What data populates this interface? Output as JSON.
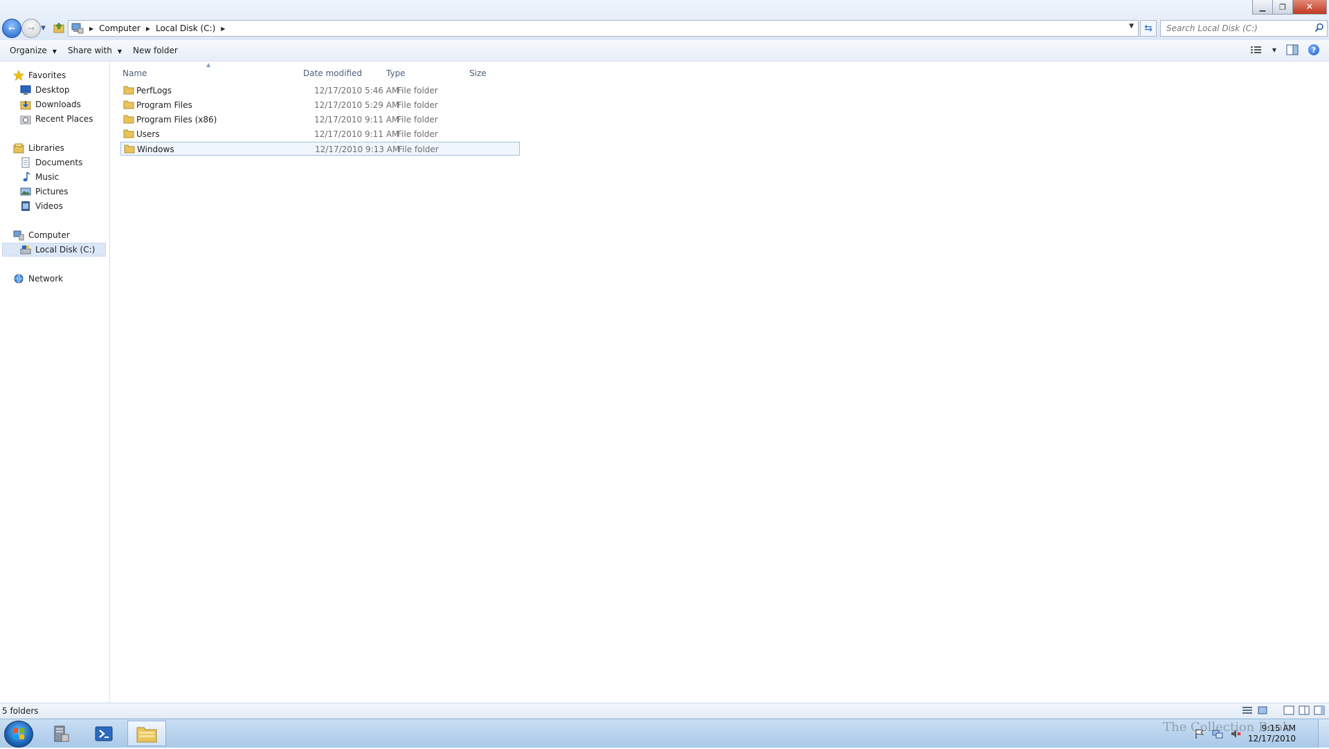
{
  "window": {
    "caption_buttons": {
      "minimize": "▁",
      "restore": "❐",
      "close": "✕"
    }
  },
  "address": {
    "breadcrumbs": [
      "Computer",
      "Local Disk (C:)"
    ],
    "search_placeholder": "Search Local Disk (C:)"
  },
  "toolbar": {
    "organize": "Organize",
    "share_with": "Share with",
    "new_folder": "New folder"
  },
  "nav": {
    "favorites": {
      "label": "Favorites",
      "items": [
        "Desktop",
        "Downloads",
        "Recent Places"
      ]
    },
    "libraries": {
      "label": "Libraries",
      "items": [
        "Documents",
        "Music",
        "Pictures",
        "Videos"
      ]
    },
    "computer": {
      "label": "Computer",
      "items": [
        "Local Disk (C:)"
      ]
    },
    "network": {
      "label": "Network"
    }
  },
  "columns": {
    "name": "Name",
    "date": "Date modified",
    "type": "Type",
    "size": "Size"
  },
  "files": [
    {
      "name": "PerfLogs",
      "date": "12/17/2010 5:46 AM",
      "type": "File folder"
    },
    {
      "name": "Program Files",
      "date": "12/17/2010 5:29 AM",
      "type": "File folder"
    },
    {
      "name": "Program Files (x86)",
      "date": "12/17/2010 9:11 AM",
      "type": "File folder"
    },
    {
      "name": "Users",
      "date": "12/17/2010 9:11 AM",
      "type": "File folder"
    },
    {
      "name": "Windows",
      "date": "12/17/2010 9:13 AM",
      "type": "File folder"
    }
  ],
  "status": {
    "text": "5 folders"
  },
  "taskbar": {
    "clock_time": "9:15 AM",
    "clock_date": "12/17/2010",
    "watermark": "The Collection Book"
  },
  "colors": {
    "accent": "#1e62c8",
    "selection": "#dbe7f7",
    "taskbar": "#b9d3ee"
  }
}
